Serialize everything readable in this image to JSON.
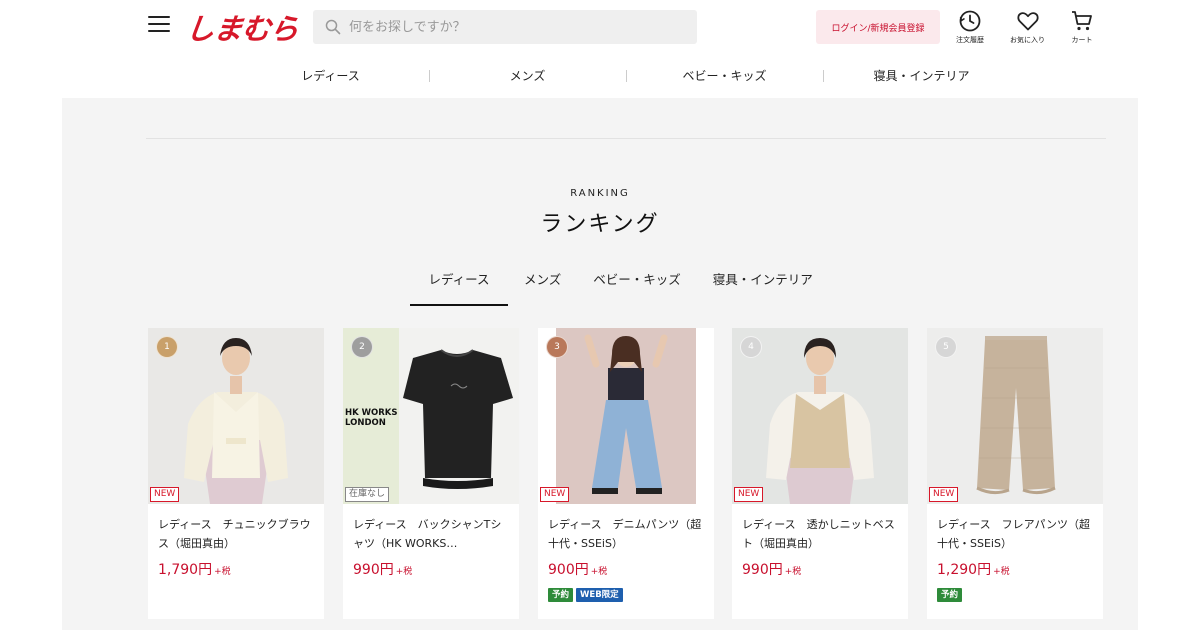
{
  "header": {
    "logo": "しまむら",
    "search_placeholder": "何をお探しですか？",
    "login_label": "ログイン/新規会員登録",
    "icons": [
      {
        "name": "order-history-icon",
        "label": "注文履歴"
      },
      {
        "name": "favorites-icon",
        "label": "お気に入り"
      },
      {
        "name": "cart-icon",
        "label": "カート"
      }
    ]
  },
  "category_nav": [
    "レディース",
    "メンズ",
    "ベビー・キッズ",
    "寝具・インテリア"
  ],
  "ranking": {
    "eyebrow": "RANKING",
    "title": "ランキング",
    "tabs": [
      "レディース",
      "メンズ",
      "ベビー・キッズ",
      "寝具・インテリア"
    ],
    "active_tab": "レディース"
  },
  "products": [
    {
      "rank": "1",
      "rank_color": "#c9a06a",
      "badge": "NEW",
      "name": "レディース　チュニックブラウス（堀田真由）",
      "price": "1,790円",
      "tax": "+税",
      "tags": []
    },
    {
      "rank": "2",
      "rank_color": "#9e9e9e",
      "badge": "在庫なし",
      "name": "レディース　バックシャンTシャツ（HK WORKS…",
      "price": "990円",
      "tax": "+税",
      "tags": []
    },
    {
      "rank": "3",
      "rank_color": "#b9785a",
      "badge": "NEW",
      "name": "レディース　デニムパンツ（超十代・SSEiS）",
      "price": "900円",
      "tax": "+税",
      "tags": [
        "予約",
        "WEB限定"
      ]
    },
    {
      "rank": "4",
      "rank_color": "#d6d6d6",
      "badge": "NEW",
      "name": "レディース　透かしニットベスト（堀田真由）",
      "price": "990円",
      "tax": "+税",
      "tags": []
    },
    {
      "rank": "5",
      "rank_color": "#d6d6d6",
      "badge": "NEW",
      "name": "レディース　フレアパンツ（超十代・SSEiS）",
      "price": "1,290円",
      "tax": "+税",
      "tags": [
        "予約"
      ]
    }
  ],
  "image_text": {
    "brand_mark": "HK WORKS\nLONDON"
  },
  "colors": {
    "brand_red": "#d7182a",
    "price_red": "#c8102e",
    "tag_green": "#2e8b3a",
    "tag_blue": "#1e5fae"
  }
}
